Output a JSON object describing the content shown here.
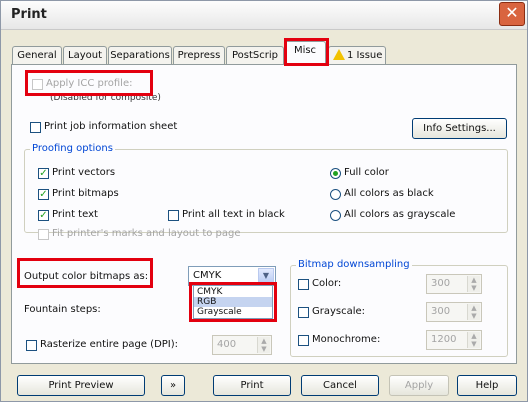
{
  "window": {
    "title": "Print",
    "close_glyph": "✕"
  },
  "tabs": [
    {
      "label": "General"
    },
    {
      "label": "Layout"
    },
    {
      "label": "Separations"
    },
    {
      "label": "Prepress"
    },
    {
      "label": "PostScrip"
    },
    {
      "label": "Misc"
    },
    {
      "label": "1 Issue"
    }
  ],
  "misc": {
    "apply_icc": {
      "label": "Apply ICC profile:",
      "checked": false,
      "enabled": false
    },
    "icc_note": "(Disabled for composite)",
    "job_info": {
      "label": "Print job information sheet",
      "checked": false
    },
    "info_settings_label": "Info Settings...",
    "proofing": {
      "legend": "Proofing options",
      "print_vectors": {
        "label": "Print vectors",
        "checked": true
      },
      "print_bitmaps": {
        "label": "Print bitmaps",
        "checked": true
      },
      "print_text": {
        "label": "Print text",
        "checked": true
      },
      "print_all_black": {
        "label": "Print all text in black",
        "checked": false
      },
      "fit_marks": {
        "label": "Fit printer's marks and layout to page",
        "checked": false,
        "enabled": false
      },
      "color_modes": [
        {
          "label": "Full color",
          "selected": true
        },
        {
          "label": "All colors as black",
          "selected": false
        },
        {
          "label": "All colors as grayscale",
          "selected": false
        }
      ]
    },
    "output_color": {
      "label": "Output color bitmaps as:",
      "value": "CMYK",
      "options": [
        "CMYK",
        "RGB",
        "Grayscale"
      ],
      "highlighted": "RGB"
    },
    "fountain_steps": {
      "label": "Fountain steps:"
    },
    "rasterize": {
      "label": "Rasterize entire page (DPI):",
      "checked": false,
      "value": "400"
    },
    "bitmap_downsampling": {
      "legend": "Bitmap downsampling",
      "color": {
        "label": "Color:",
        "checked": false,
        "value": "300"
      },
      "grayscale": {
        "label": "Grayscale:",
        "checked": false,
        "value": "300"
      },
      "monochrome": {
        "label": "Monochrome:",
        "checked": false,
        "value": "1200"
      }
    }
  },
  "footer": {
    "print_preview": "Print Preview",
    "preview_expand": "»",
    "print": "Print",
    "cancel": "Cancel",
    "apply": "Apply",
    "help": "Help"
  },
  "colors": {
    "accent_green": "#21a121",
    "highlight_red": "#e3000f",
    "group_blue": "#0046d5"
  },
  "icons": {
    "issue_tab": "warning-icon",
    "close": "close-icon"
  }
}
